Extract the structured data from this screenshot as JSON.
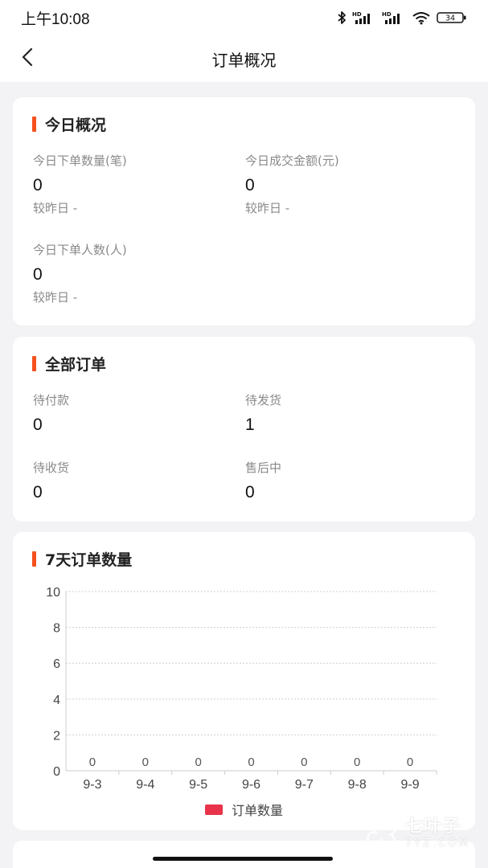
{
  "status_bar": {
    "time": "上午10:08",
    "icons": [
      "bluetooth-icon",
      "signal-hd-icon",
      "signal-hd-icon",
      "wifi-icon",
      "battery-icon"
    ],
    "hd_label": "HD",
    "battery": "34"
  },
  "nav": {
    "back_icon": "chevron-left-icon",
    "title": "订单概况"
  },
  "today": {
    "title": "今日概况",
    "accent": "#f4511e",
    "metrics": [
      {
        "label": "今日下单数量(笔)",
        "value": "0",
        "compare": "较昨日 -"
      },
      {
        "label": "今日成交金额(元)",
        "value": "0",
        "compare": "较昨日 -"
      },
      {
        "label": "今日下单人数(人)",
        "value": "0",
        "compare": "较昨日 -"
      }
    ]
  },
  "all_orders": {
    "title": "全部订单",
    "items": [
      {
        "label": "待付款",
        "value": "0"
      },
      {
        "label": "待发货",
        "value": "1"
      },
      {
        "label": "待收货",
        "value": "0"
      },
      {
        "label": "售后中",
        "value": "0"
      }
    ]
  },
  "weekly": {
    "title": "7天订单数量"
  },
  "chart_data": {
    "type": "bar",
    "categories": [
      "9-3",
      "9-4",
      "9-5",
      "9-6",
      "9-7",
      "9-8",
      "9-9"
    ],
    "series": [
      {
        "name": "订单数量",
        "values": [
          0,
          0,
          0,
          0,
          0,
          0,
          0
        ],
        "color": "#e8334a"
      }
    ],
    "data_labels": [
      "0",
      "0",
      "0",
      "0",
      "0",
      "0",
      "0"
    ],
    "yticks": [
      "0",
      "2",
      "4",
      "6",
      "8",
      "10"
    ],
    "ylim": [
      0,
      10
    ],
    "grid": true,
    "legend": "bottom-center"
  },
  "watermark": {
    "name": "七叶子",
    "domain": "7YZ.COM"
  }
}
